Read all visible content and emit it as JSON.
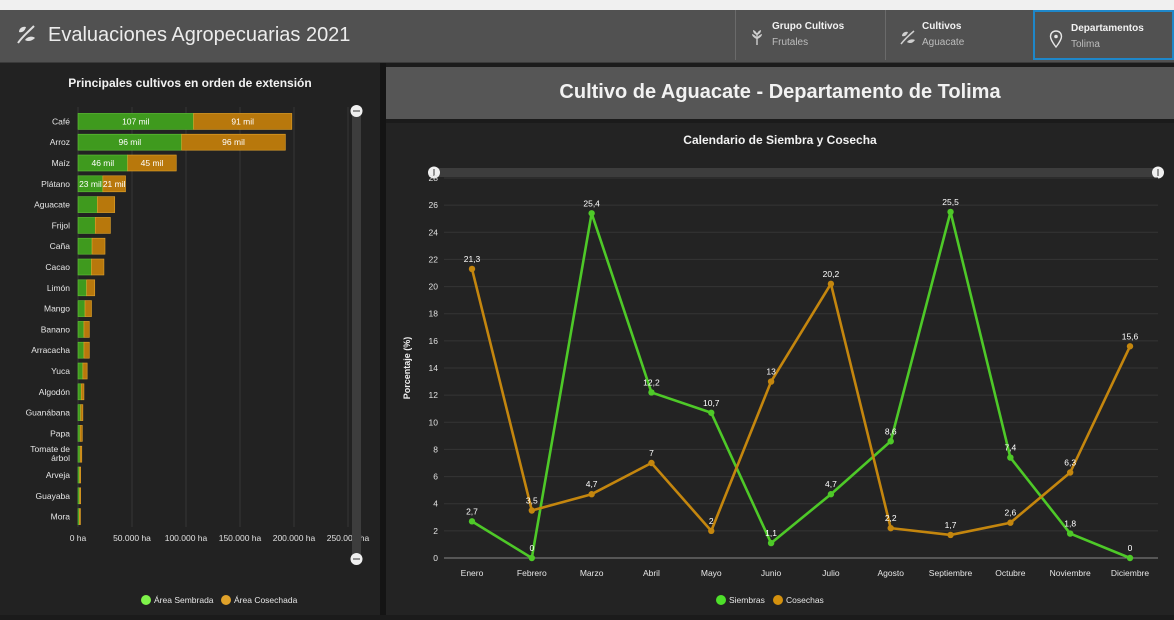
{
  "app": {
    "title": "Evaluaciones Agropecuarias 2021"
  },
  "filters": [
    {
      "title": "Grupo Cultivos",
      "value": "Frutales",
      "icon": "wheat-icon"
    },
    {
      "title": "Cultivos",
      "value": "Aguacate",
      "icon": "sprout-icon"
    },
    {
      "title": "Departamentos",
      "value": "Tolima",
      "icon": "map-pin-icon"
    }
  ],
  "banner": {
    "title": "Cultivo de Aguacate - Departamento de Tolima"
  },
  "colors": {
    "sembrada": "#3f9a1e",
    "cosechada": "#b8780c",
    "siembras": "#4ec928",
    "cosechas": "#c4860e"
  },
  "chart_data": [
    {
      "type": "bar",
      "orientation": "horizontal",
      "stacked": true,
      "title": "Principales cultivos en orden de extensión",
      "categories": [
        "Café",
        "Arroz",
        "Maíz",
        "Plátano",
        "Aguacate",
        "Frijol",
        "Caña",
        "Cacao",
        "Limón",
        "Mango",
        "Banano",
        "Arracacha",
        "Yuca",
        "Algodón",
        "Guanábana",
        "Papa",
        "Tomate de árbol",
        "Arveja",
        "Guayaba",
        "Mora"
      ],
      "series": [
        {
          "name": "Área Sembrada",
          "values": [
            107000,
            96000,
            46000,
            23000,
            18000,
            16000,
            13000,
            12500,
            8000,
            6500,
            5500,
            5500,
            4500,
            3000,
            2500,
            2000,
            2000,
            1500,
            1500,
            1300
          ],
          "labels": [
            "107 mil",
            "96 mil",
            "46 mil",
            "23 mil",
            "",
            "",
            "",
            "",
            "",
            "",
            "",
            "",
            "",
            "",
            "",
            "",
            "",
            "",
            "",
            ""
          ]
        },
        {
          "name": "Área Cosechada",
          "values": [
            91000,
            96000,
            45000,
            21000,
            16000,
            14000,
            12000,
            11500,
            7500,
            6000,
            5000,
            5000,
            4000,
            2500,
            2000,
            2000,
            1500,
            1000,
            1000,
            1000
          ],
          "labels": [
            "91 mil",
            "96 mil",
            "45 mil",
            "21 mil",
            "",
            "",
            "",
            "",
            "",
            "",
            "",
            "",
            "",
            "",
            "",
            "",
            "",
            "",
            "",
            ""
          ]
        }
      ],
      "x_ticks": [
        "0 ha",
        "50.000 ha",
        "100.000 ha",
        "150.000 ha",
        "200.000 ha",
        "250.000 ha"
      ],
      "xlim": [
        0,
        250000
      ],
      "legend_position": "bottom",
      "grid": true
    },
    {
      "type": "line",
      "title": "Calendario de Siembra y Cosecha",
      "ylabel": "Porcentaje (%)",
      "categories": [
        "Enero",
        "Febrero",
        "Marzo",
        "Abril",
        "Mayo",
        "Junio",
        "Julio",
        "Agosto",
        "Septiembre",
        "Octubre",
        "Noviembre",
        "Diciembre"
      ],
      "series": [
        {
          "name": "Siembras",
          "values": [
            2.7,
            0,
            25.4,
            12.2,
            10.7,
            1.1,
            4.7,
            8.6,
            25.5,
            7.4,
            1.8,
            0
          ],
          "labels": [
            "2,7",
            "0",
            "25,4",
            "12,2",
            "10,7",
            "1,1",
            "4,7",
            "8,6",
            "25,5",
            "7,4",
            "1,8",
            "0"
          ]
        },
        {
          "name": "Cosechas",
          "values": [
            21.3,
            3.5,
            4.7,
            7,
            2,
            13,
            20.2,
            2.2,
            1.7,
            2.6,
            6.3,
            15.6
          ],
          "labels": [
            "21,3",
            "3,5",
            "4,7",
            "7",
            "2",
            "13",
            "20,2",
            "2,2",
            "1,7",
            "2,6",
            "6,3",
            "15,6"
          ]
        }
      ],
      "y_ticks": [
        "0",
        "2",
        "4",
        "6",
        "8",
        "10",
        "12",
        "14",
        "16",
        "18",
        "20",
        "22",
        "24",
        "26",
        "28"
      ],
      "ylim": [
        0,
        28
      ],
      "legend_position": "bottom",
      "grid": true
    }
  ]
}
